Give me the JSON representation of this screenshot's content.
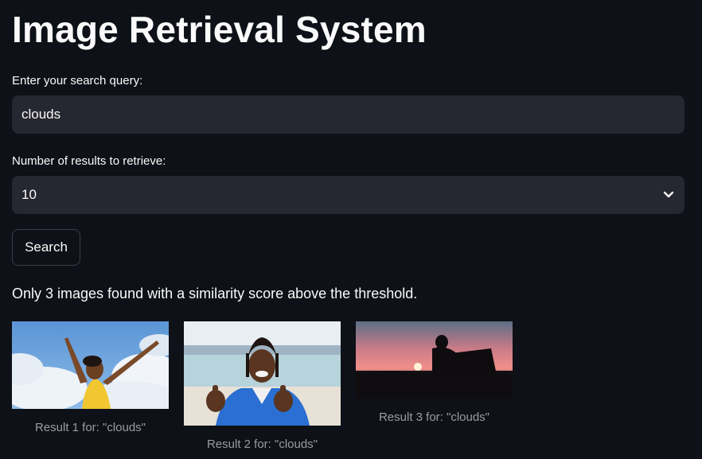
{
  "header": {
    "title": "Image Retrieval System"
  },
  "query": {
    "label": "Enter your search query:",
    "value": "clouds"
  },
  "num_results": {
    "label": "Number of results to retrieve:",
    "selected": "10"
  },
  "search_button": {
    "label": "Search"
  },
  "status": {
    "message": "Only 3 images found with a similarity score above the threshold."
  },
  "results": [
    {
      "caption": "Result 1 for: \"clouds\""
    },
    {
      "caption": "Result 2 for: \"clouds\""
    },
    {
      "caption": "Result 3 for: \"clouds\""
    }
  ],
  "colors": {
    "background": "#0e1117",
    "input_bg": "#262730",
    "text": "#fafafa",
    "caption": "#9a9ca3",
    "button_border": "#3d3f4a"
  },
  "icons": {
    "select_indicator": "chevron-down-icon"
  }
}
